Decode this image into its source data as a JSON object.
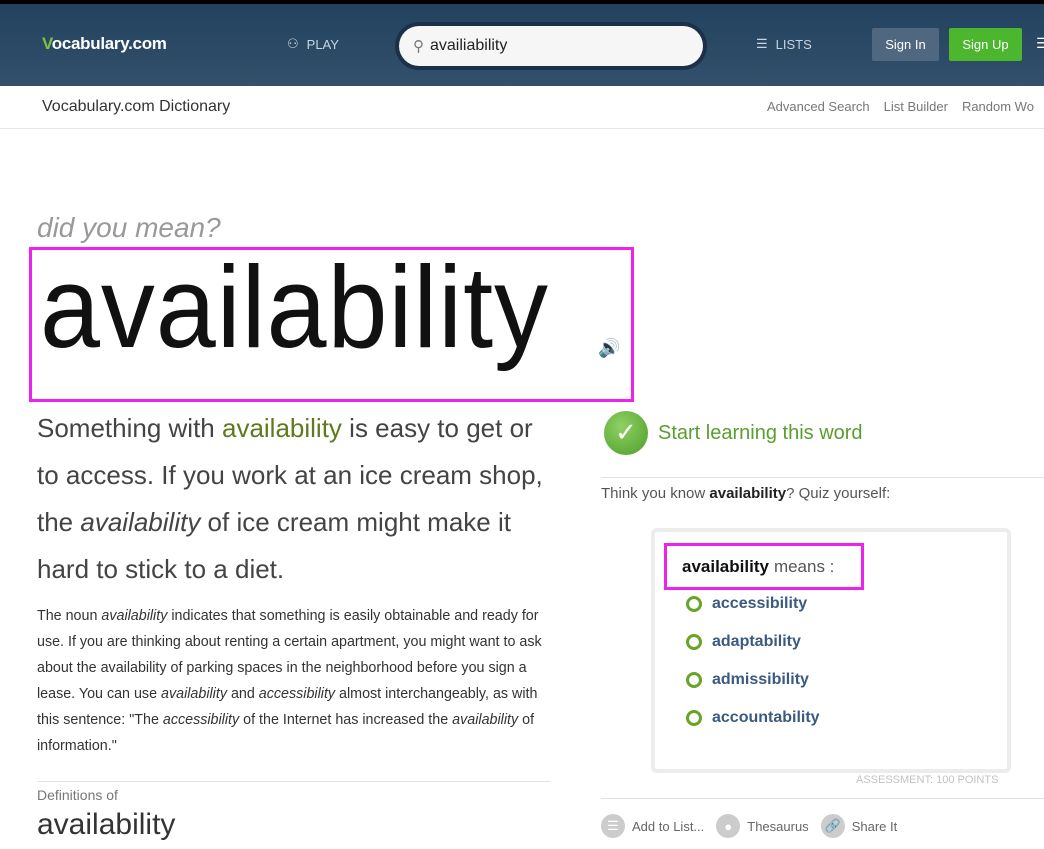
{
  "header": {
    "logo_v": "V",
    "logo_rest": "ocabulary.com",
    "play": "PLAY",
    "search_value": "availiability",
    "lists": "LISTS",
    "sign_in": "Sign In",
    "sign_up": "Sign Up"
  },
  "subnav": {
    "title": "Vocabulary.com Dictionary",
    "links": [
      "Advanced Search",
      "List Builder",
      "Random Wo"
    ]
  },
  "entry": {
    "did_you_mean": "did you mean?",
    "word": "availability",
    "short_pre": "Something with ",
    "short_hl": "availability",
    "short_mid": " is easy to get or to access. If you work at an ice cream shop, the ",
    "short_em": "availability",
    "short_post": " of ice cream might make it hard to stick to a diet.",
    "long": [
      {
        "t": "The noun "
      },
      {
        "t": "availability",
        "i": true
      },
      {
        "t": " indicates that something is easily obtainable and ready for use. If you are thinking about renting a certain apartment, you might want to ask about the availability of parking spaces in the neighborhood before you sign a lease. You can use "
      },
      {
        "t": "availability",
        "i": true
      },
      {
        "t": " and "
      },
      {
        "t": "accessibility",
        "i": true
      },
      {
        "t": " almost interchangeably, as with this sentence: \"The "
      },
      {
        "t": "accessibility",
        "i": true
      },
      {
        "t": " of the Internet has increased the "
      },
      {
        "t": "availability",
        "i": true
      },
      {
        "t": " of information.\""
      }
    ],
    "definitions_of": "Definitions of",
    "definitions_word": "availability"
  },
  "learn": {
    "label": "Start learning this word"
  },
  "quiz": {
    "prompt_pre": "Think you know ",
    "prompt_word": "availability",
    "prompt_post": "? Quiz yourself:",
    "means_word": "availability",
    "means": "means :",
    "options": [
      "accessibility",
      "adaptability",
      "admissibility",
      "accountability"
    ],
    "assessment": "ASSESSMENT: 100 POINTS"
  },
  "actions": [
    {
      "label": "Add to List...",
      "icon": "list-icon"
    },
    {
      "label": "Thesaurus",
      "icon": "thesaurus-icon"
    },
    {
      "label": "Share It",
      "icon": "link-icon"
    }
  ],
  "colors": {
    "header": "#22425f",
    "sign_up": "#4cb62f",
    "accent_green": "#5a9e2f",
    "highlight": "#ee22ee"
  }
}
